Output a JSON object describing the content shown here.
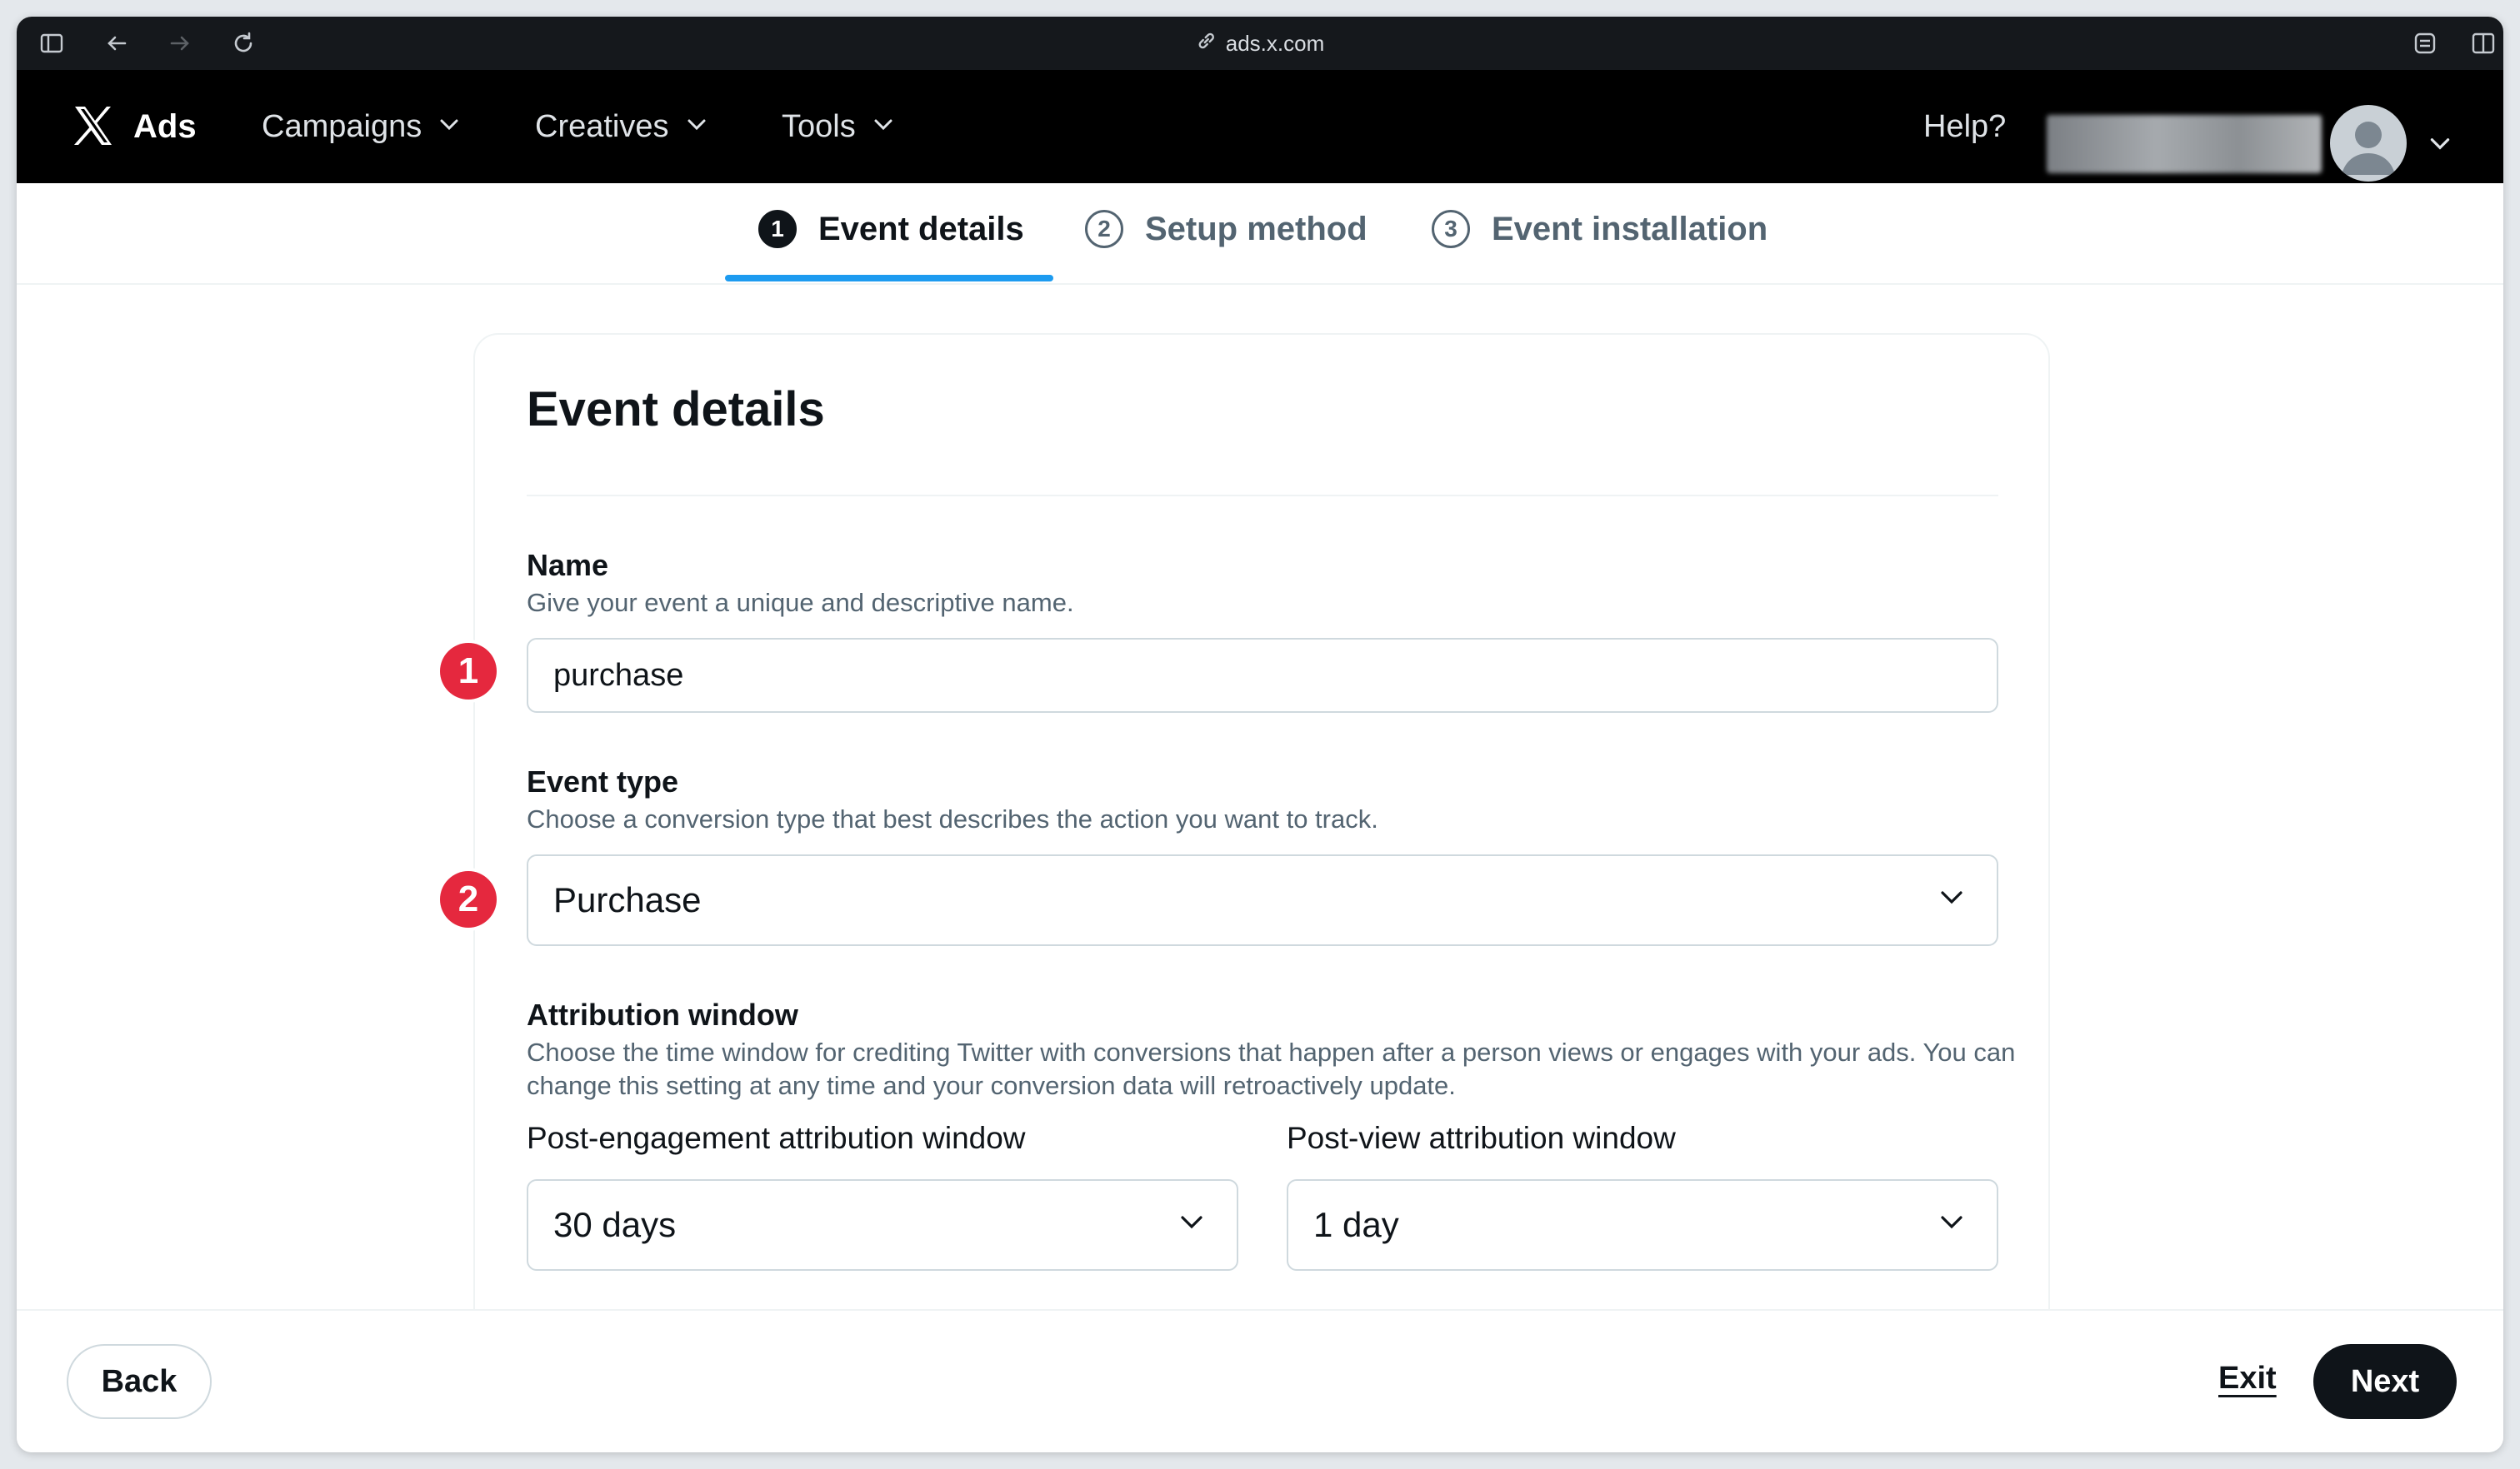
{
  "browser": {
    "url": "ads.x.com",
    "icons": [
      "sidebar-toggle-icon",
      "back-arrow-icon",
      "forward-arrow-icon",
      "reload-icon",
      "link-icon",
      "extensions-icon",
      "split-view-icon"
    ]
  },
  "header": {
    "brand": "Ads",
    "nav": [
      {
        "label": "Campaigns"
      },
      {
        "label": "Creatives"
      },
      {
        "label": "Tools"
      }
    ],
    "help": "Help?"
  },
  "stepper": {
    "steps": [
      {
        "number": "1",
        "label": "Event details",
        "active": true
      },
      {
        "number": "2",
        "label": "Setup method",
        "active": false
      },
      {
        "number": "3",
        "label": "Event installation",
        "active": false
      }
    ],
    "accent": "#1d9bf0"
  },
  "form": {
    "title": "Event details",
    "name": {
      "label": "Name",
      "help": "Give your event a unique and descriptive name.",
      "value": "purchase",
      "badge": "1"
    },
    "event_type": {
      "label": "Event type",
      "help": "Choose a conversion type that best describes the action you want to track.",
      "value": "Purchase",
      "badge": "2"
    },
    "attribution": {
      "label": "Attribution window",
      "help": "Choose the time window for crediting Twitter with conversions that happen after a person views or engages with your ads. You can change this setting at any time and your conversion data will retroactively update.",
      "post_engagement": {
        "label": "Post-engagement attribution window",
        "value": "30 days"
      },
      "post_view": {
        "label": "Post-view attribution window",
        "value": "1 day"
      }
    }
  },
  "footer": {
    "back": "Back",
    "exit": "Exit",
    "next": "Next"
  },
  "colors": {
    "badge": "#e5283e",
    "primary_button": "#0f1419"
  }
}
